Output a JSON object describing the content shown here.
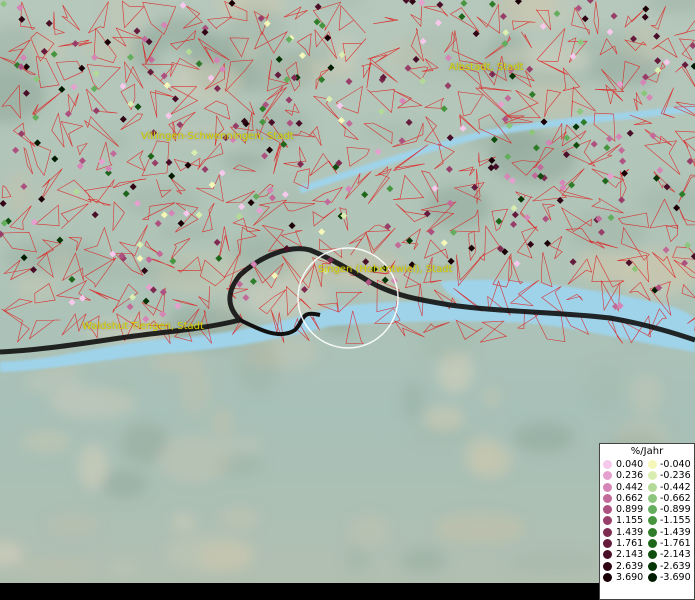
{
  "map": {
    "cities": [
      {
        "name": "Albstadt, Stadt"
      },
      {
        "name": "Villingen-Schwenningen, Stadt"
      },
      {
        "name": "Singen (Hohentwiel), Stadt"
      },
      {
        "name": "Waldshut-Tiengen, Stadt"
      }
    ],
    "colors": {
      "terrain": "#a9bfb5",
      "lake": "#a6d8ec",
      "boundary": "#e01818",
      "border": "#111111",
      "label": "#d9d200"
    }
  },
  "legend": {
    "title": "%/Jahr",
    "positive": {
      "values": [
        "0.040",
        "0.236",
        "0.442",
        "0.662",
        "0.899",
        "1.155",
        "1.439",
        "1.761",
        "2.143",
        "2.639",
        "3.690"
      ],
      "colors": [
        "#f6c8ec",
        "#e6a0cf",
        "#d585b6",
        "#c26b9a",
        "#ad5280",
        "#973f69",
        "#7e2b51",
        "#651c3c",
        "#4a0f28",
        "#310515",
        "#1a0006"
      ]
    },
    "negative": {
      "values": [
        "-0.040",
        "-0.236",
        "-0.442",
        "-0.662",
        "-0.899",
        "-1.155",
        "-1.439",
        "-1.761",
        "-2.143",
        "-2.639",
        "-3.690"
      ],
      "colors": [
        "#f4f7b8",
        "#d9edb0",
        "#b4da98",
        "#8cc67c",
        "#64ad5d",
        "#47953f",
        "#2f7d2a",
        "#1e661b",
        "#104d0f",
        "#063506",
        "#001c00"
      ]
    }
  }
}
